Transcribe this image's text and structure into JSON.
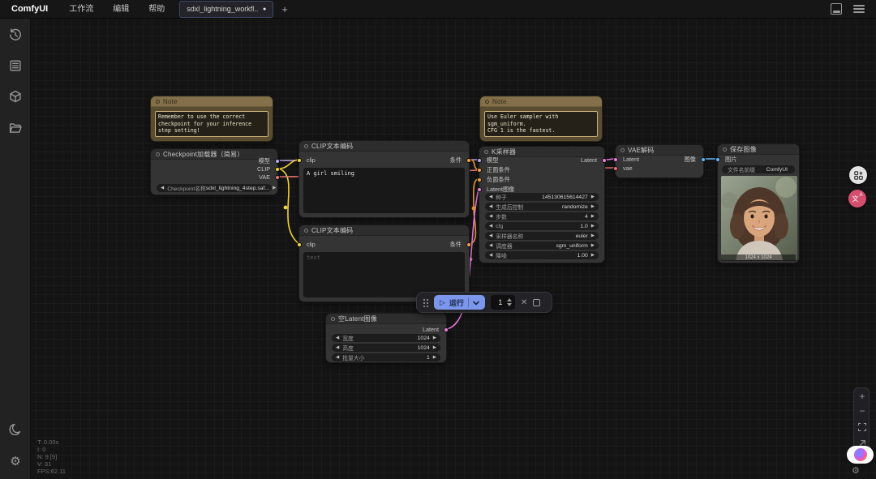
{
  "topbar": {
    "logo": "ComfyUI",
    "menus": [
      {
        "label": "工作流"
      },
      {
        "label": "编辑"
      },
      {
        "label": "帮助"
      }
    ],
    "tab": {
      "label": "sdxl_lightning_workfl...",
      "modified": "●"
    },
    "new_tab_label": "+"
  },
  "perf": {
    "lines": [
      "T: 0.00s",
      "I: 0",
      "N: 9 [9]",
      "V: 31",
      "FPS:62.11"
    ]
  },
  "runbar": {
    "run_label": "运行",
    "count": "1"
  },
  "nodes": {
    "note_left": {
      "title": "Note",
      "text": "Remember to use the correct checkpoint for your inference step setting!"
    },
    "note_right": {
      "title": "Note",
      "text": "Use Euler sampler with sgm_uniform.\nCFG 1 is the fastest."
    },
    "checkpoint": {
      "title": "Checkpoint加载器（简易）",
      "outputs": [
        "模型",
        "CLIP",
        "VAE"
      ],
      "widget": {
        "label": "Checkpoint名称",
        "value": "sdxl_lightning_4step.saf..."
      }
    },
    "clip_positive": {
      "title": "CLIP文本编码",
      "input": "clip",
      "output": "条件",
      "text": "A girl smiling"
    },
    "clip_negative": {
      "title": "CLIP文本编码",
      "input": "clip",
      "output": "条件",
      "placeholder": "text"
    },
    "ksampler": {
      "title": "K采样器",
      "inputs": [
        "模型",
        "正面条件",
        "负面条件",
        "Latent图像"
      ],
      "output": "Latent",
      "widgets": [
        {
          "label": "种子",
          "value": "145130615614427"
        },
        {
          "label": "生成后控制",
          "value": "randomize"
        },
        {
          "label": "步数",
          "value": "4"
        },
        {
          "label": "cfg",
          "value": "1.0"
        },
        {
          "label": "采样器名称",
          "value": "euler"
        },
        {
          "label": "调度器",
          "value": "sgm_uniform"
        },
        {
          "label": "降噪",
          "value": "1.00"
        }
      ]
    },
    "vae_decode": {
      "title": "VAE解码",
      "inputs": [
        "Latent",
        "vae"
      ],
      "output": "图像"
    },
    "save_image": {
      "title": "保存图像",
      "input": "图片",
      "widget": {
        "label": "文件名前缀",
        "value": "ComfyUI"
      },
      "image_caption": "1024 x 1024"
    },
    "empty_latent": {
      "title": "空Latent图像",
      "output": "Latent",
      "widgets": [
        {
          "label": "宽度",
          "value": "1024"
        },
        {
          "label": "高度",
          "value": "1024"
        },
        {
          "label": "批量大小",
          "value": "1"
        }
      ]
    }
  },
  "glyphs": {
    "left": "◀",
    "right": "▶",
    "play": "▷",
    "close": "✕",
    "plus": "+",
    "minus": "−"
  },
  "translate_button": {
    "char_main": "文",
    "char_sub": "A"
  },
  "colors": {
    "model": "#b8a6e8",
    "clip": "#f2d23b",
    "vae": "#e8766f",
    "conditioning": "#f0a03c",
    "latent": "#ef7bde",
    "image": "#64b5f6",
    "accent_blue": "#7b96ea",
    "note_bg": "#5a4c30"
  }
}
